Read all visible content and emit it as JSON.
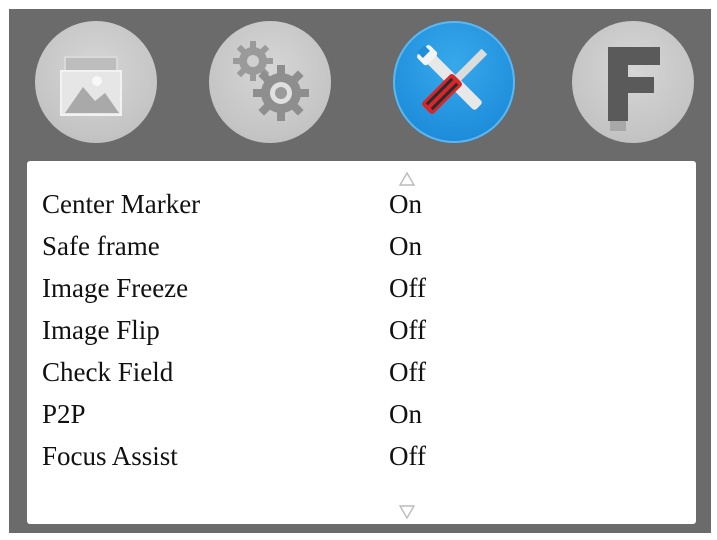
{
  "tabs": [
    {
      "name": "image-tab",
      "icon": "picture-icon",
      "active": false
    },
    {
      "name": "system-tab",
      "icon": "gears-icon",
      "active": false
    },
    {
      "name": "tools-tab",
      "icon": "wrench-screwdriver-icon",
      "active": true
    },
    {
      "name": "function-tab",
      "icon": "letter-f-icon",
      "active": false,
      "glyph": "F"
    }
  ],
  "menu": {
    "items": [
      {
        "label": "Center Marker",
        "value": "On"
      },
      {
        "label": "Safe frame",
        "value": "On"
      },
      {
        "label": "Image Freeze",
        "value": "Off"
      },
      {
        "label": "Image Flip",
        "value": "Off"
      },
      {
        "label": "Check Field",
        "value": "Off"
      },
      {
        "label": "P2P",
        "value": "On"
      },
      {
        "label": "Focus Assist",
        "value": "Off"
      }
    ]
  },
  "colors": {
    "background": "#6b6b6b",
    "active_tab": "#1f8fdc",
    "inactive_tab": "#c4c4c4",
    "panel": "#ffffff"
  }
}
